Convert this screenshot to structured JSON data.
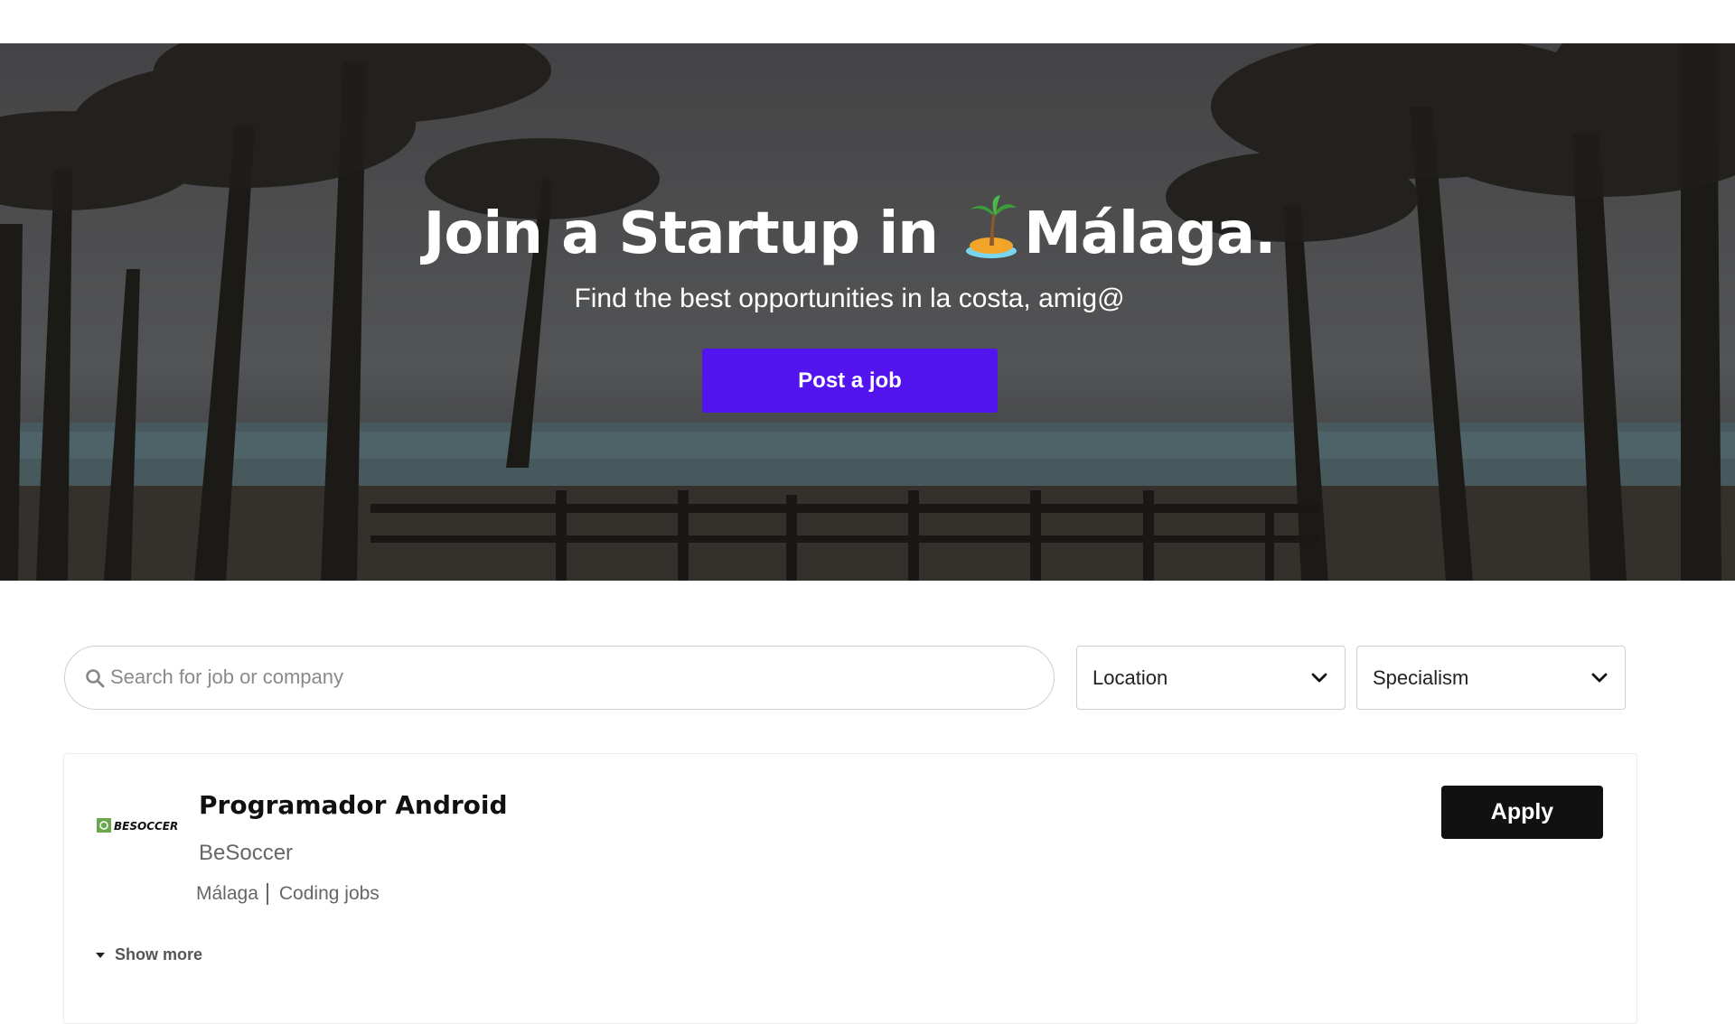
{
  "hero": {
    "title_part1": "Join a Startup in ",
    "title_emoji": "palm-island-icon",
    "title_part2": "Málaga.",
    "subtitle": "Find the best opportunities in la costa, amig@",
    "post_job_label": "Post a job"
  },
  "filters": {
    "search_placeholder": "Search for job or company",
    "location_label": "Location",
    "specialism_label": "Specialism"
  },
  "jobs": [
    {
      "title": "Programador Android",
      "company": "BeSoccer",
      "location": "Málaga",
      "category": "Coding jobs",
      "apply_label": "Apply",
      "show_more_label": "Show more",
      "logo_text": "BESOCCER"
    }
  ],
  "colors": {
    "primary": "#5314f0",
    "apply": "#111111",
    "logo_green": "#6aa84f"
  }
}
